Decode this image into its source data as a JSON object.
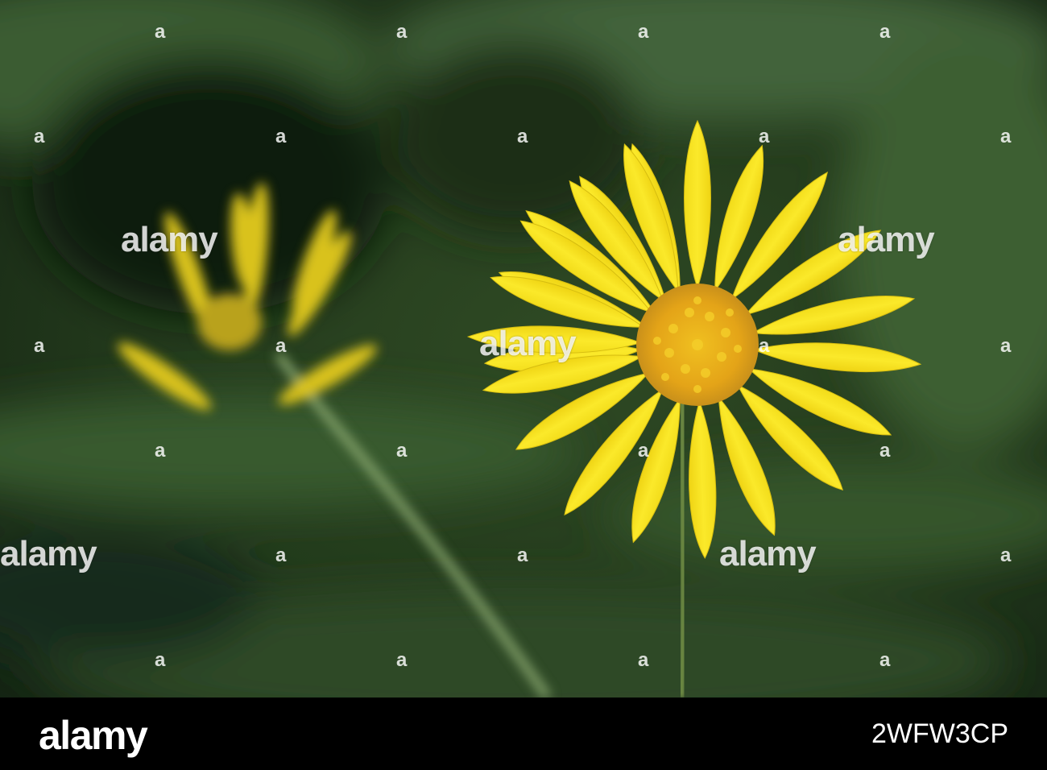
{
  "watermark": {
    "text": "alamy",
    "mark": "a"
  },
  "footer": {
    "brand": "alamy",
    "image_id": "2WFW3CP"
  },
  "colors": {
    "background_green": "#3a5a2c",
    "petal_yellow": "#f6e11c",
    "center_orange": "#e7a81a",
    "footer_bg": "#000000"
  }
}
